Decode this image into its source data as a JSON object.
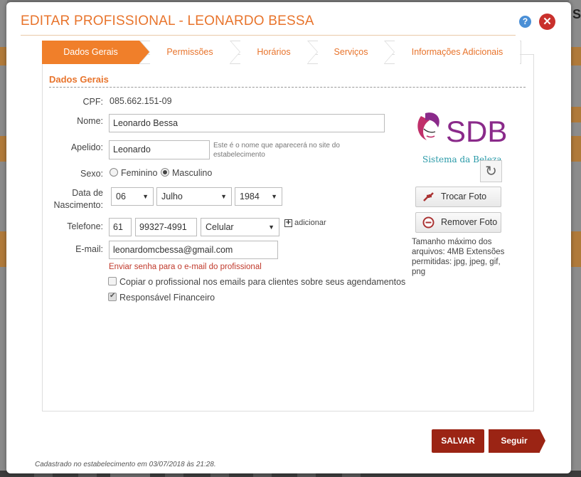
{
  "modal": {
    "title": "EDITAR PROFISSIONAL - LEONARDO BESSA",
    "help_glyph": "?",
    "close_glyph": "✕"
  },
  "tabs": [
    {
      "label": "Dados Gerais",
      "active": true
    },
    {
      "label": "Permissões",
      "active": false
    },
    {
      "label": "Horários",
      "active": false
    },
    {
      "label": "Serviços",
      "active": false
    },
    {
      "label": "Informações Adicionais",
      "active": false
    }
  ],
  "section": {
    "title": "Dados Gerais"
  },
  "form": {
    "cpf_label": "CPF:",
    "cpf_value": "085.662.151-09",
    "nome_label": "Nome:",
    "nome_value": "Leonardo Bessa",
    "apelido_label": "Apelido:",
    "apelido_value": "Leonardo",
    "apelido_hint": "Este é o nome que aparecerá no site do estabelecimento",
    "sexo_label": "Sexo:",
    "sexo_options": [
      "Feminino",
      "Masculino"
    ],
    "sexo_selected": "Masculino",
    "nascimento_label_1": "Data de",
    "nascimento_label_2": "Nascimento:",
    "dia": "06",
    "mes": "Julho",
    "ano": "1984",
    "telefone_label": "Telefone:",
    "ddd": "61",
    "telefone": "99327-4991",
    "tipo_telefone": "Celular",
    "adicionar": "adicionar",
    "email_label": "E-mail:",
    "email_value": "leonardomcbessa@gmail.com",
    "enviar_senha": "Enviar senha para o e-mail do profissional",
    "copiar_label": "Copiar o profissional nos emails para clientes sobre seus agendamentos",
    "copiar_checked": false,
    "responsavel_label": "Responsável Financeiro",
    "responsavel_checked": true
  },
  "photo": {
    "logo_text": "SDB",
    "logo_subtitle": "Sistema da Beleza",
    "trocar_label": "Trocar Foto",
    "remover_label": "Remover Foto",
    "size_note": "Tamanho máximo dos arquivos: 4MB Extensões permitidas: jpg, jpeg, gif, png"
  },
  "actions": {
    "salvar": "SALVAR",
    "seguir": "Seguir"
  },
  "footer": {
    "note": "Cadastrado no estabelecimento em 03/07/2018 às 21:28."
  },
  "colors": {
    "accent": "#f07f2a",
    "title": "#e8742c",
    "primary_button": "#9b2414",
    "link_red": "#c0392b"
  }
}
